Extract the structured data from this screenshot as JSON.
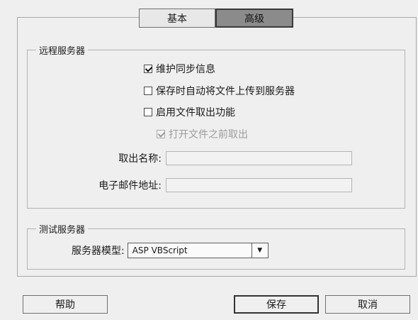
{
  "tabs": [
    {
      "label": "基本",
      "active": false
    },
    {
      "label": "高级",
      "active": true
    }
  ],
  "remote_group": {
    "legend": "远程服务器",
    "options": [
      {
        "label": "维护同步信息",
        "checked": true,
        "disabled": false
      },
      {
        "label": "保存时自动将文件上传到服务器",
        "checked": false,
        "disabled": false
      },
      {
        "label": "启用文件取出功能",
        "checked": false,
        "disabled": false
      },
      {
        "label": "打开文件之前取出",
        "checked": true,
        "disabled": true
      }
    ],
    "checkout_name_label": "取出名称:",
    "checkout_name_value": "",
    "email_label": "电子邮件地址:",
    "email_value": ""
  },
  "test_group": {
    "legend": "测试服务器",
    "model_label": "服务器模型:",
    "model_value": "ASP VBScript"
  },
  "buttons": {
    "help": "帮助",
    "save": "保存",
    "cancel": "取消"
  }
}
